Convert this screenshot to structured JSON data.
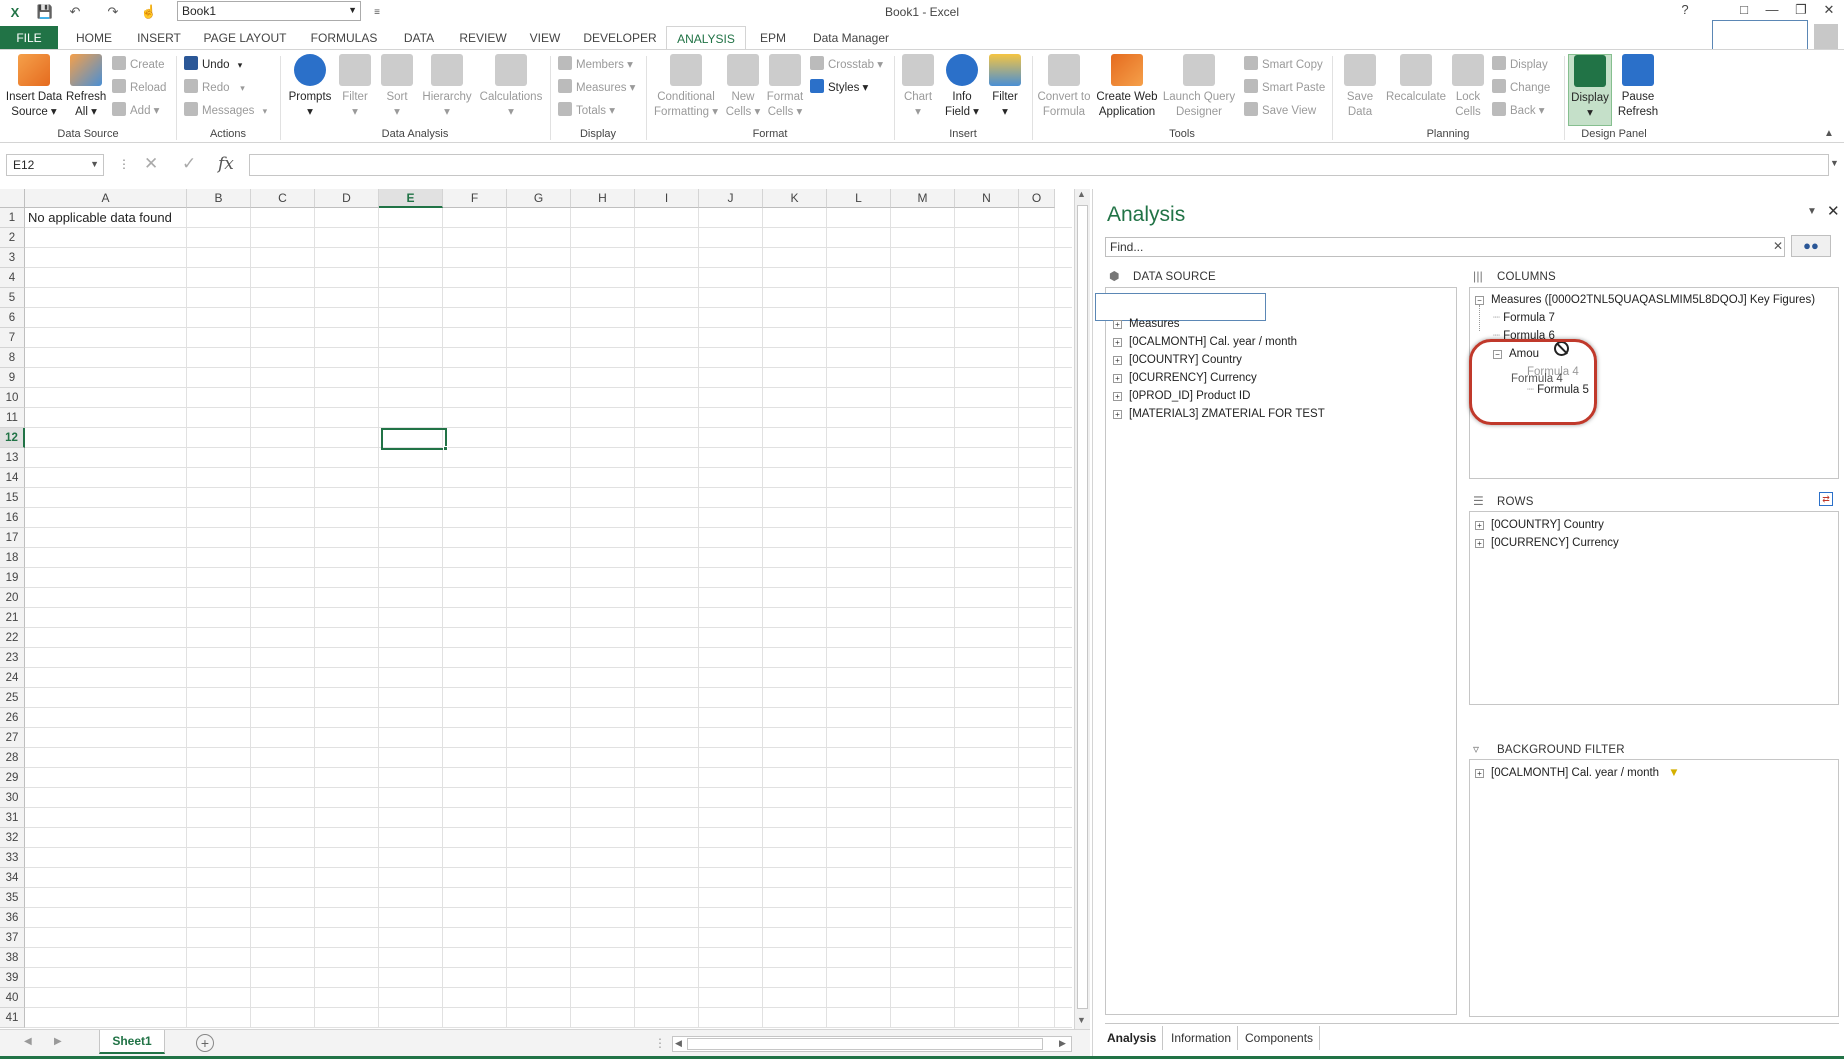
{
  "titlebar": {
    "doc_name": "Book1",
    "window_title": "Book1 - Excel",
    "help": "?"
  },
  "tabs": [
    "FILE",
    "HOME",
    "INSERT",
    "PAGE LAYOUT",
    "FORMULAS",
    "DATA",
    "REVIEW",
    "VIEW",
    "DEVELOPER",
    "ANALYSIS",
    "EPM",
    "Data Manager"
  ],
  "active_tab": "ANALYSIS",
  "ribbon": {
    "data_source": {
      "label": "Data Source",
      "insert": "Insert Data\nSource ▾",
      "refresh": "Refresh\nAll ▾",
      "create": "Create",
      "reload": "Reload",
      "add": "Add ▾"
    },
    "actions": {
      "label": "Actions",
      "undo": "Undo",
      "redo": "Redo",
      "messages": "Messages"
    },
    "data_analysis": {
      "label": "Data Analysis",
      "prompts": "Prompts\n▾",
      "filter": "Filter\n▾",
      "sort": "Sort\n▾",
      "hierarchy": "Hierarchy\n▾",
      "calculations": "Calculations\n▾"
    },
    "display": {
      "label": "Display",
      "members": "Members ▾",
      "measures": "Measures ▾",
      "totals": "Totals ▾"
    },
    "format": {
      "label": "Format",
      "conditional": "Conditional\nFormatting ▾",
      "new_cells": "New\nCells ▾",
      "format_cells": "Format\nCells ▾",
      "crosstab": "Crosstab ▾",
      "styles": "Styles ▾"
    },
    "insert": {
      "label": "Insert",
      "chart": "Chart\n▾",
      "info_field": "Info\nField ▾",
      "filter": "Filter\n▾"
    },
    "tools": {
      "label": "Tools",
      "convert": "Convert to\nFormula",
      "create_web": "Create Web\nApplication",
      "launch_query": "Launch Query\nDesigner",
      "smart_copy": "Smart Copy",
      "smart_paste": "Smart Paste",
      "save_view": "Save View"
    },
    "planning": {
      "label": "Planning",
      "save_data": "Save\nData",
      "recalculate": "Recalculate",
      "lock_cells": "Lock\nCells",
      "display": "Display",
      "change": "Change",
      "back": "Back ▾"
    },
    "design_panel": {
      "label": "Design Panel",
      "display": "Display\n▾",
      "pause_refresh": "Pause\nRefresh"
    }
  },
  "formula_bar": {
    "name_box": "E12",
    "fx": "fx",
    "value": ""
  },
  "grid": {
    "columns": [
      "A",
      "B",
      "C",
      "D",
      "E",
      "F",
      "G",
      "H",
      "I",
      "J",
      "K",
      "L",
      "M",
      "N",
      "O"
    ],
    "rows": [
      "1",
      "2",
      "3",
      "4",
      "5",
      "6",
      "7",
      "8",
      "9",
      "10",
      "11",
      "12",
      "13",
      "14",
      "15",
      "16",
      "17",
      "18",
      "19",
      "20",
      "21",
      "22",
      "23",
      "24",
      "25",
      "26",
      "27",
      "28",
      "29",
      "30",
      "31",
      "32",
      "33",
      "34",
      "35",
      "36",
      "37",
      "38",
      "39",
      "40",
      "41"
    ],
    "selected_cell": "E12",
    "a1_value": "No applicable data found"
  },
  "sheet_tabs": {
    "active": "Sheet1",
    "add": "+"
  },
  "panel": {
    "title": "Analysis",
    "find_placeholder": "Find...",
    "data_source_header": "DATA SOURCE",
    "columns_header": "COLUMNS",
    "rows_header": "ROWS",
    "bg_filter_header": "BACKGROUND FILTER",
    "data_source_items": [
      "Measures",
      "[0CALMONTH] Cal. year / month",
      "[0COUNTRY] Country",
      "[0CURRENCY] Currency",
      "[0PROD_ID] Product ID",
      "[MATERIAL3] ZMATERIAL FOR TEST"
    ],
    "columns_items": {
      "root": "Measures ([000O2TNL5QUAQASLMIM5L8DQOJ] Key Figures)",
      "f7": "Formula 7",
      "f6": "Formula 6",
      "amount": "Amou",
      "f4": "Formula 4",
      "f5": "Formula 5",
      "drag_ghost": "Formula 4"
    },
    "rows_items": [
      "[0COUNTRY] Country",
      "[0CURRENCY] Currency"
    ],
    "bg_filter_items": [
      "[0CALMONTH] Cal. year / month"
    ],
    "bottom_tabs": [
      "Analysis",
      "Information",
      "Components"
    ]
  },
  "colors": {
    "excel_green": "#217346",
    "highlight_red": "#c0392b"
  }
}
